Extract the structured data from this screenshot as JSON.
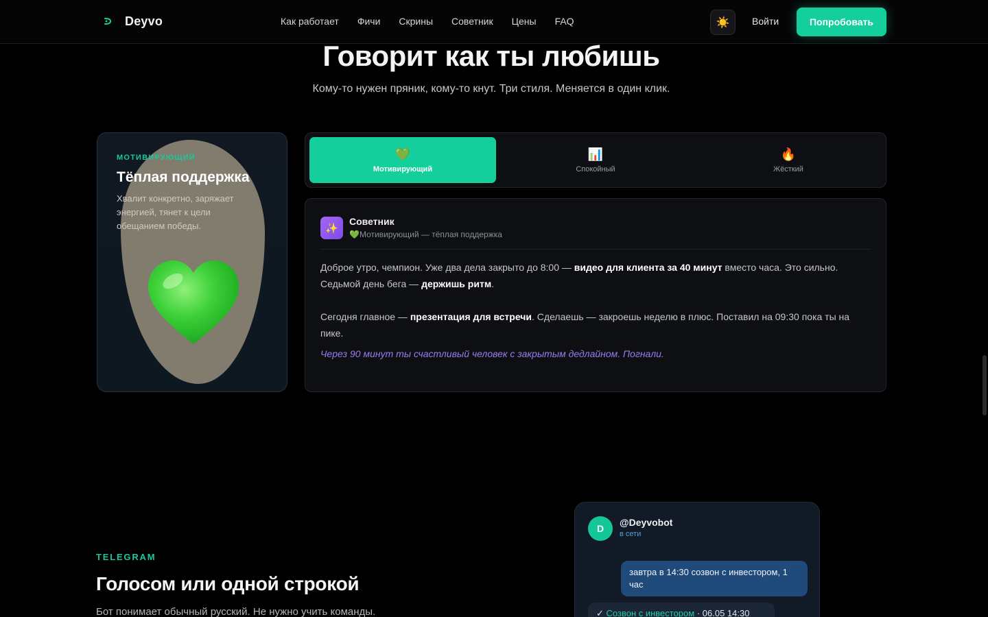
{
  "nav": {
    "logo_text": "Deyvo",
    "links": [
      "Как работает",
      "Фичи",
      "Скрины",
      "Советник",
      "Цены",
      "FAQ"
    ],
    "theme_icon": "sun-icon",
    "login": "Войти",
    "cta": "Попробовать"
  },
  "hero": {
    "title": "Говорит как ты любишь",
    "subtitle": "Кому-то нужен пряник, кому-то кнут. Три стиля. Меняется в один клик."
  },
  "style_card": {
    "tag": "МОТИВИРУЮЩИЙ",
    "title": "Тёплая поддержка",
    "description": "Хвалит конкретно, заряжает энергией, тянет к цели обещанием победы.",
    "icon": "green-heart-icon"
  },
  "tabs": [
    {
      "emoji": "💚",
      "label": "Мотивирующий",
      "active": true
    },
    {
      "emoji": "📊",
      "label": "Спокойный",
      "active": false
    },
    {
      "emoji": "🔥",
      "label": "Жёсткий",
      "active": false
    }
  ],
  "advisor": {
    "avatar_emoji": "✨",
    "name": "Советник",
    "subtitle": "💚Мотивирующий — тёплая поддержка",
    "p1_a": "Доброе утро, чемпион. Уже два дела закрыто до 8:00 — ",
    "p1_b": "видео для клиента за 40 минут",
    "p1_c": " вместо часа. Это сильно. Седьмой день бега — ",
    "p1_d": "держишь ритм",
    "p1_e": ".",
    "p2_a": "Сегодня главное — ",
    "p2_b": "презентация для встречи",
    "p2_c": ". Сделаешь — закроешь неделю в плюс. Поставил на 09:30 пока ты на пике.",
    "quote": "Через 90 минут ты счастливый человек с закрытым дедлайном. Погнали."
  },
  "telegram": {
    "tag": "TELEGRAM",
    "title": "Голосом или одной строкой",
    "description": "Бот понимает обычный русский. Не нужно учить команды.",
    "chat": {
      "avatar_letter": "D",
      "name": "@Deyvobot",
      "status": "в сети",
      "user_message": "завтра в 14:30 созвон с инвестором, 1 час",
      "bot_check": "✓ ",
      "bot_event": "Созвон с инвестором",
      "bot_time": " · 06.05 14:30"
    }
  },
  "colors": {
    "accent": "#14cf9c",
    "background": "#000000",
    "quote_purple": "#9b7bf0"
  }
}
